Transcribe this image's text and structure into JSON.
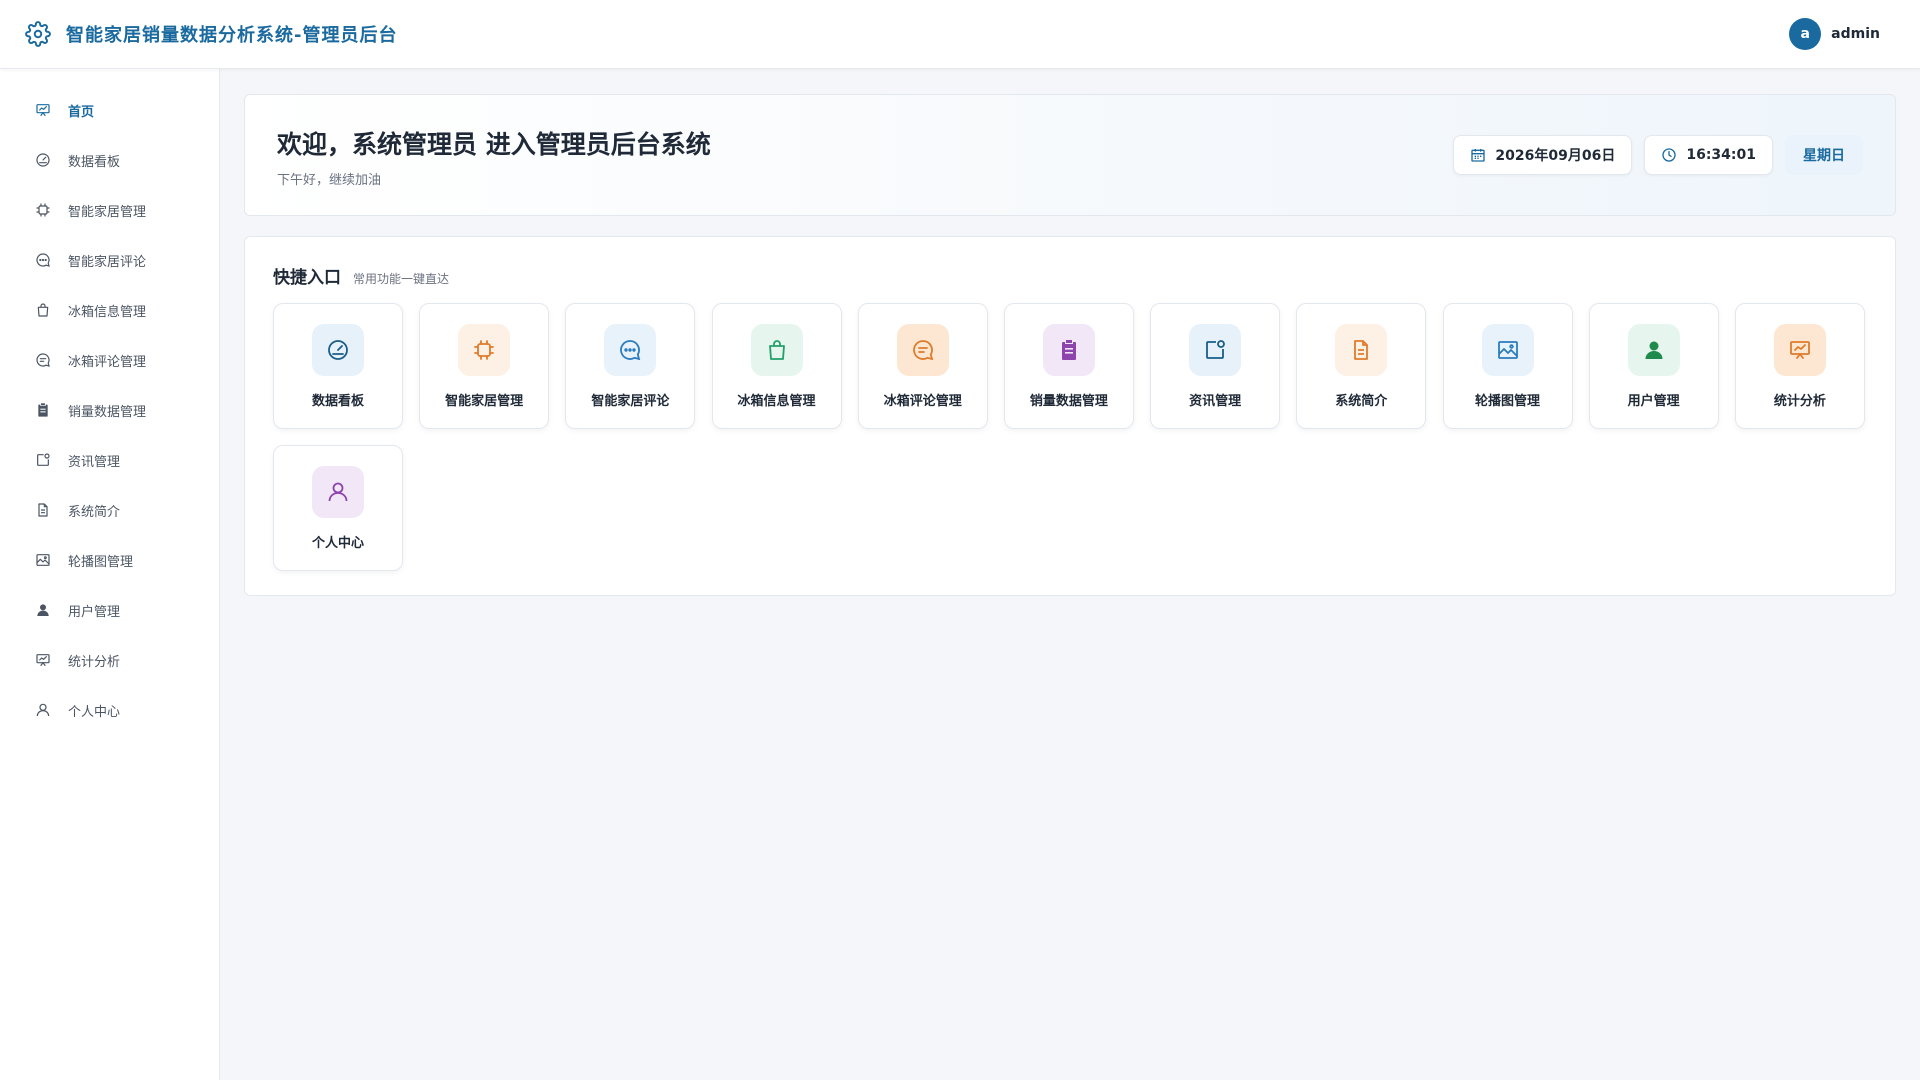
{
  "header": {
    "title": "智能家居销量数据分析系统-管理员后台",
    "logo_icon": "gear-icon",
    "user": {
      "avatar_letter": "a",
      "name": "admin"
    }
  },
  "sidebar": {
    "items": [
      {
        "label": "首页",
        "icon": "presentation-icon",
        "active": true
      },
      {
        "label": "数据看板",
        "icon": "speedometer-icon"
      },
      {
        "label": "智能家居管理",
        "icon": "chip-icon"
      },
      {
        "label": "智能家居评论",
        "icon": "chat-dots-icon"
      },
      {
        "label": "冰箱信息管理",
        "icon": "shopping-bag-icon"
      },
      {
        "label": "冰箱评论管理",
        "icon": "chat-lines-icon"
      },
      {
        "label": "销量数据管理",
        "icon": "clipboard-icon"
      },
      {
        "label": "资讯管理",
        "icon": "notification-icon"
      },
      {
        "label": "系统简介",
        "icon": "document-icon"
      },
      {
        "label": "轮播图管理",
        "icon": "image-icon"
      },
      {
        "label": "用户管理",
        "icon": "user-filled-icon"
      },
      {
        "label": "统计分析",
        "icon": "presentation-icon"
      },
      {
        "label": "个人中心",
        "icon": "user-outline-icon"
      }
    ]
  },
  "welcome": {
    "headline": "欢迎，系统管理员 进入管理员后台系统",
    "subline": "下午好，继续加油",
    "date": "2026年09月06日",
    "time": "16:34:01",
    "weekday": "星期日"
  },
  "quick": {
    "title": "快捷入口",
    "subtitle": "常用功能一键直达",
    "tiles": [
      {
        "label": "数据看板",
        "icon": "speedometer-icon",
        "color": "#1a5d8a",
        "bg": "#e6f1fa"
      },
      {
        "label": "智能家居管理",
        "icon": "chip-icon",
        "color": "#e07b2b",
        "bg": "#fdf0e4"
      },
      {
        "label": "智能家居评论",
        "icon": "chat-dots-icon",
        "color": "#2b7cbf",
        "bg": "#e8f2fb"
      },
      {
        "label": "冰箱信息管理",
        "icon": "shopping-bag-icon",
        "color": "#22a06b",
        "bg": "#e6f6ee"
      },
      {
        "label": "冰箱评论管理",
        "icon": "chat-lines-icon",
        "color": "#e07b2b",
        "bg": "#fde7d3"
      },
      {
        "label": "销量数据管理",
        "icon": "clipboard-icon",
        "color": "#8e44ad",
        "bg": "#f1e7f7"
      },
      {
        "label": "资讯管理",
        "icon": "notification-icon",
        "color": "#1a5d8a",
        "bg": "#e6f1fa"
      },
      {
        "label": "系统简介",
        "icon": "document-icon",
        "color": "#e07b2b",
        "bg": "#fdf0e4"
      },
      {
        "label": "轮播图管理",
        "icon": "image-icon",
        "color": "#2b7cbf",
        "bg": "#e8f2fb"
      },
      {
        "label": "用户管理",
        "icon": "user-filled-icon",
        "color": "#1e8a4c",
        "bg": "#e6f6ee"
      },
      {
        "label": "统计分析",
        "icon": "presentation-icon",
        "color": "#e07b2b",
        "bg": "#fde7d3"
      },
      {
        "label": "个人中心",
        "icon": "user-outline-icon",
        "color": "#8e44ad",
        "bg": "#f1e7f7"
      }
    ]
  },
  "colors": {
    "brand": "#1a6aa0",
    "sidebar_icon": "#4b5563",
    "page_bg": "#f4f6f9"
  }
}
